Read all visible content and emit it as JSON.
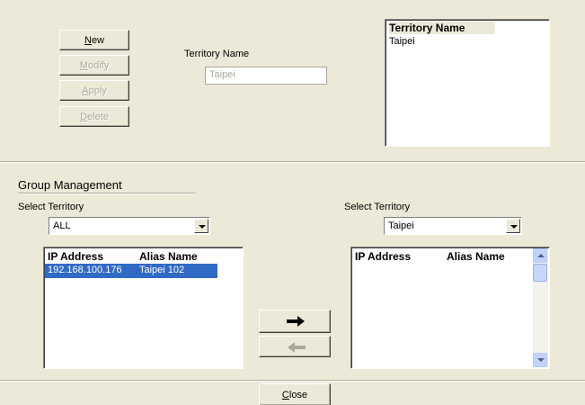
{
  "territory": {
    "buttons": {
      "new": {
        "u": "N",
        "rest": "ew"
      },
      "modify": {
        "u": "M",
        "rest": "odify"
      },
      "apply": {
        "u": "A",
        "rest": "pply"
      },
      "delete": {
        "u": "D",
        "rest": "elete"
      }
    },
    "name_label": "Territory Name",
    "name_value": "Taipei",
    "list_header": "Territory Name",
    "list_items": [
      "Taipei"
    ]
  },
  "group": {
    "title": "Group Management",
    "left": {
      "select_label": "Select Territory",
      "select_value": "ALL",
      "col_ip": "IP Address",
      "col_alias": "Alias Name",
      "rows": [
        {
          "ip": "192.168.100.176",
          "alias": "Taipei 102",
          "selected": true
        }
      ]
    },
    "right": {
      "select_label": "Select Territory",
      "select_value": "Taipei",
      "col_ip": "IP Address",
      "col_alias": "Alias Name",
      "rows": []
    }
  },
  "footer": {
    "close": {
      "u": "C",
      "rest": "lose"
    }
  },
  "colors": {
    "selection": "#316ac5",
    "window_bg": "#ece9d8"
  }
}
